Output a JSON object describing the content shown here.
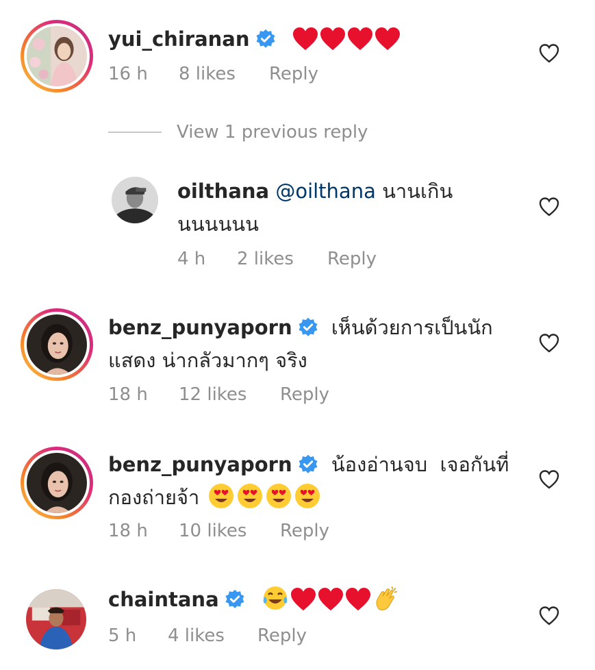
{
  "comments": [
    {
      "username": "yui_chiranan",
      "verified": true,
      "text_line1": "",
      "text_line2": "",
      "emojis": [
        "red-heart",
        "red-heart",
        "red-heart",
        "red-heart"
      ],
      "time": "16 h",
      "likes": "8 likes",
      "reply": "Reply",
      "has_story_ring": true
    },
    {
      "username": "oilthana",
      "verified": false,
      "mention": "@oilthana",
      "text_line1": "นานเกิน",
      "text_line2": "นนนนนน",
      "time": "4 h",
      "likes": "2 likes",
      "reply": "Reply",
      "has_story_ring": false
    },
    {
      "username": "benz_punyaporn",
      "verified": true,
      "text_line1": "เห็นด้วยการเป็นนัก",
      "text_line2": "แสดง น่ากลัวมากๆ จริง",
      "time": "18 h",
      "likes": "12 likes",
      "reply": "Reply",
      "has_story_ring": true
    },
    {
      "username": "benz_punyaporn",
      "verified": true,
      "text_line1": "น้องอ่านจบ  เจอกันที่",
      "text_line2": "กองถ่ายจ้า",
      "emojis_line2": [
        "heart-eyes-face",
        "heart-eyes-face",
        "heart-eyes-face",
        "heart-eyes-face"
      ],
      "time": "18 h",
      "likes": "10 likes",
      "reply": "Reply",
      "has_story_ring": true
    },
    {
      "username": "chaintana",
      "verified": true,
      "emojis": [
        "tears-of-joy-face",
        "red-heart",
        "red-heart",
        "red-heart",
        "clapping-hands"
      ],
      "time": "5 h",
      "likes": "4 likes",
      "reply": "Reply",
      "has_story_ring": false
    }
  ],
  "view_replies_label": "View 1 previous reply",
  "colors": {
    "primary_text": "#262626",
    "secondary_text": "#8e8e8e",
    "mention": "#00376b",
    "verified_blue": "#3897f0",
    "heart_red": "#e8112d"
  }
}
